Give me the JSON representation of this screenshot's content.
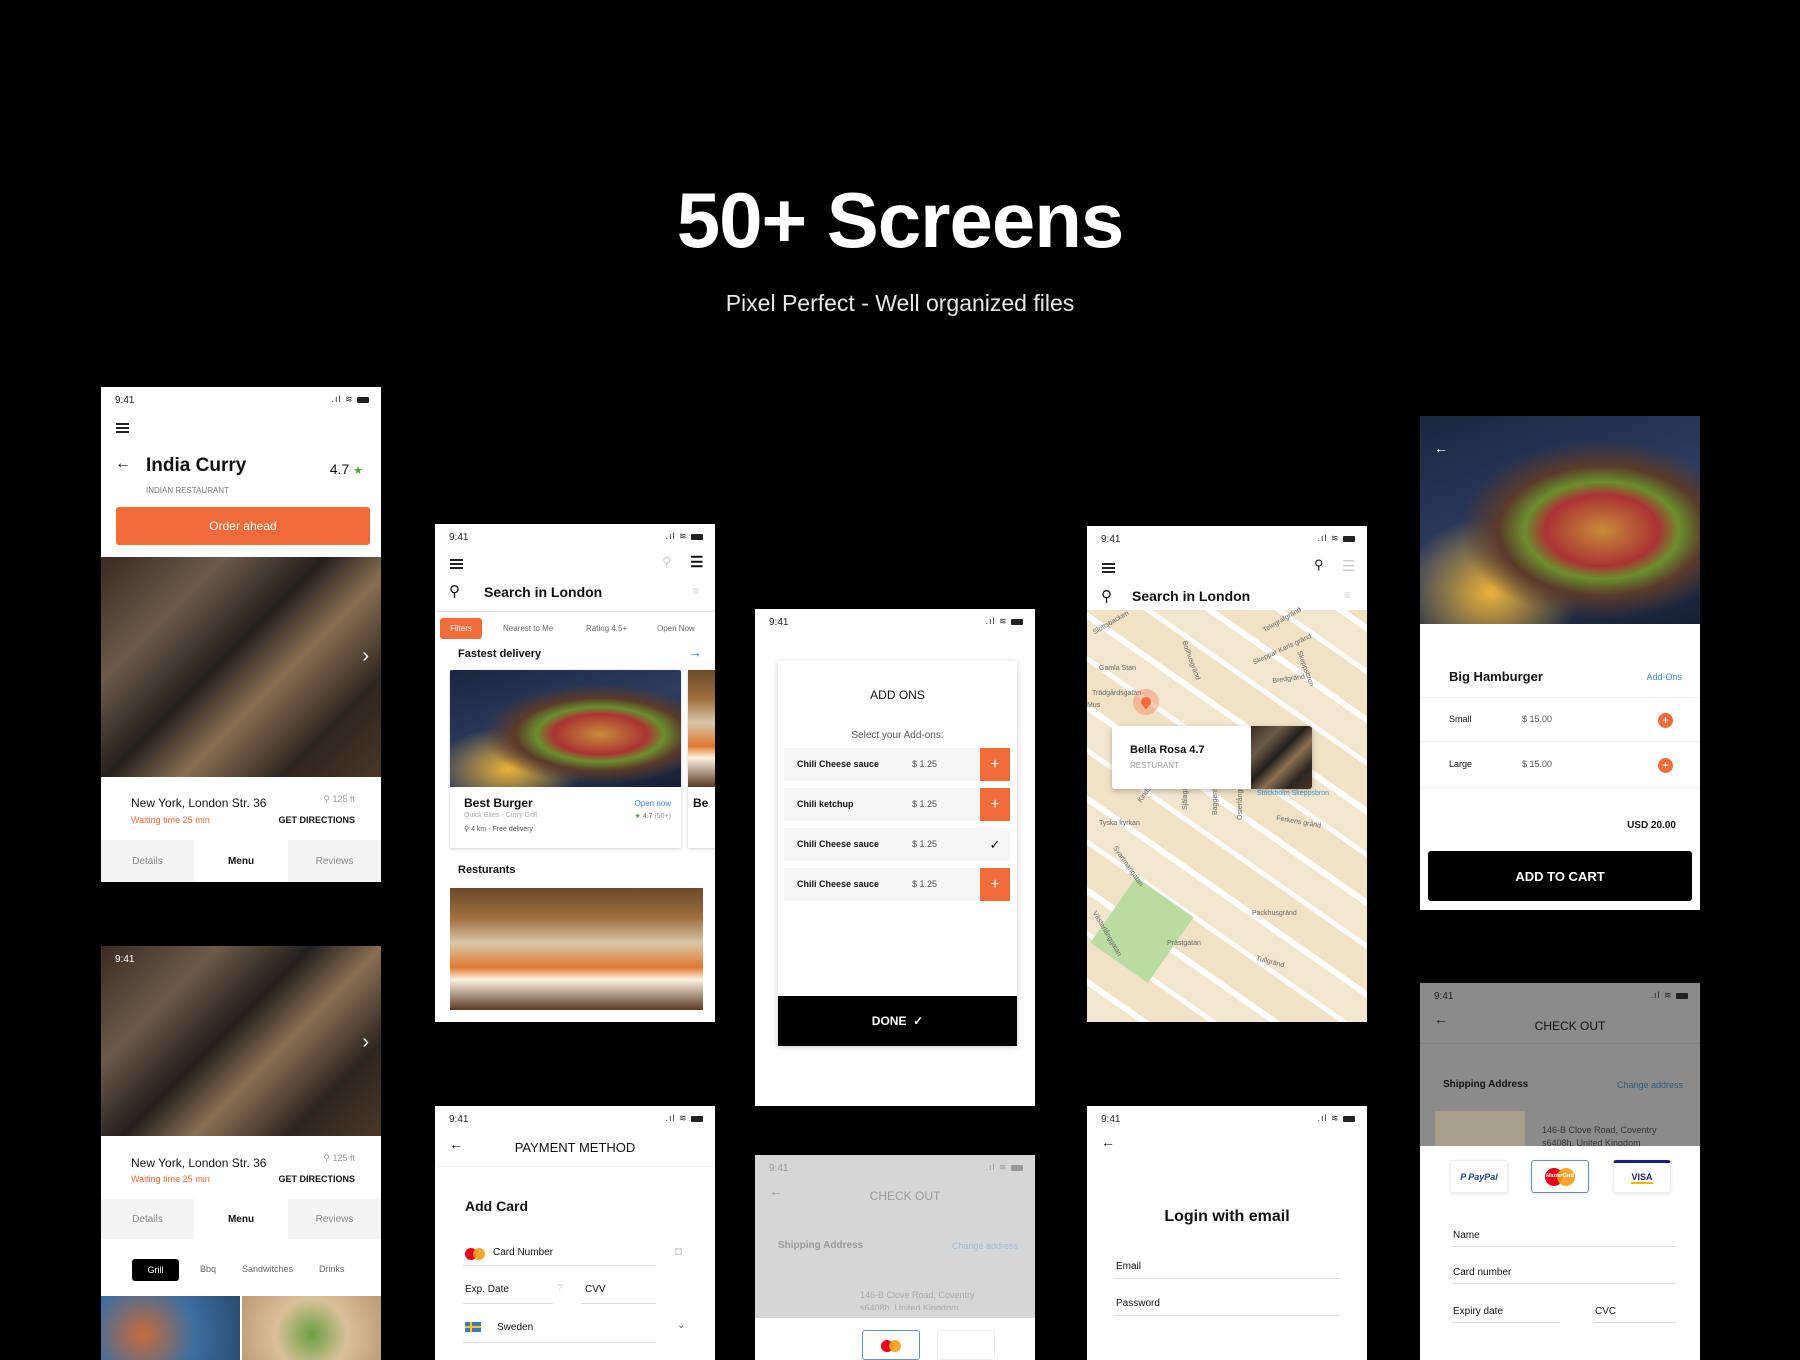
{
  "hero": {
    "title": "50+ Screens",
    "subtitle": "Pixel Perfect - Well organized files"
  },
  "status_time": "9:41",
  "colors": {
    "accent": "#f26b3a",
    "link": "#3b82d6",
    "star": "#5a9e3a",
    "dark": "#000000"
  },
  "restaurant_screen": {
    "name": "India Curry",
    "rating": "4.7",
    "category": "INDIAN RESTAURANT",
    "order_button": "Order ahead",
    "address": "New York, London Str. 36",
    "waiting": "Waiting time 25 min",
    "distance": "125 ft",
    "directions": "GET DIRECTIONS",
    "tabs": [
      "Details",
      "Menu",
      "Reviews"
    ],
    "active_tab": "Menu"
  },
  "menu_screen": {
    "address": "New York, London Str. 36",
    "waiting": "Waiting time 25 min",
    "distance": "125 ft",
    "directions": "GET DIRECTIONS",
    "tabs": [
      "Details",
      "Menu",
      "Reviews"
    ],
    "categories": [
      "Grill",
      "Bbq",
      "Sandwitches",
      "Drinks"
    ],
    "active_category": "Grill"
  },
  "search_screen": {
    "title": "Search in London",
    "chips": [
      "Filters",
      "Nearest to Me",
      "Rating 4.5+",
      "Open Now"
    ],
    "section1": "Fastest delivery",
    "card": {
      "name": "Best Burger",
      "status": "Open now",
      "sub": "Quick Bites - Curry Grill",
      "rating": "4.7",
      "reviews": "(50+)",
      "delivery": "4 km - Free delivery"
    },
    "card2_partial": "Be",
    "section2": "Resturants"
  },
  "addons_screen": {
    "title": "ADD ONS",
    "subtitle": "Select your Add-ons:",
    "items": [
      {
        "name": "Chili Cheese sauce",
        "price": "$ 1.25",
        "selected": false
      },
      {
        "name": "Chili ketchup",
        "price": "$ 1.25",
        "selected": false
      },
      {
        "name": "Chili Cheese sauce",
        "price": "$ 1.25",
        "selected": true
      },
      {
        "name": "Chili Cheese sauce",
        "price": "$ 1.25",
        "selected": false
      }
    ],
    "done": "DONE"
  },
  "map_screen": {
    "title": "Search in London",
    "popup": {
      "name": "Bella Rosa 4.7",
      "type": "RESTURANT"
    },
    "labels": [
      "Slottsbacken",
      "Gamla Stan",
      "Trädgårdsgatan",
      "Mus",
      "Telegrafgränd",
      "Skeppar Karls gränd",
      "Bredgränd",
      "Bollhusgränd",
      "Skeppsbron",
      "Skottgränd",
      "Stockholm Skeppsbron",
      "Kindstugatan",
      "Själagårdsgatan",
      "Baggensgatan",
      "Österlånggatan",
      "Ferkens gränd",
      "Tyska kyrkan",
      "Svartmangatan",
      "Packhusgränd",
      "Västerlånggatan",
      "Prästgatan",
      "Tullgränd"
    ]
  },
  "product_screen": {
    "name": "Big Hamburger",
    "addons_link": "Add-Ons",
    "sizes": [
      {
        "label": "Small",
        "price": "$ 15.00"
      },
      {
        "label": "Large",
        "price": "$ 15.00"
      }
    ],
    "total": "USD 20.00",
    "cta": "ADD TO CART"
  },
  "payment_screen": {
    "title": "PAYMENT METHOD",
    "heading": "Add Card",
    "card_number": "Card Number",
    "exp": "Exp. Date",
    "cvv": "CVV",
    "country": "Sweden"
  },
  "checkout_dim": {
    "title": "CHECK OUT",
    "shipping": "Shipping Address",
    "change": "Change address",
    "address1": "146-B Clove Road, Coventry",
    "address2": "s6408h, United Kingdom"
  },
  "login_screen": {
    "title": "Login with email",
    "email": "Email",
    "password": "Password"
  },
  "checkout_screen": {
    "title": "CHECK OUT",
    "shipping": "Shipping Address",
    "change": "Change address",
    "address1": "146-B Clove Road, Coventry",
    "address2": "s6408h, United Kingdom",
    "methods": [
      "PayPal",
      "MasterCard",
      "VISA"
    ],
    "selected_method": "MasterCard",
    "fields": {
      "name": "Name",
      "card": "Card number",
      "expiry": "Expiry date",
      "cvc": "CVC"
    }
  }
}
